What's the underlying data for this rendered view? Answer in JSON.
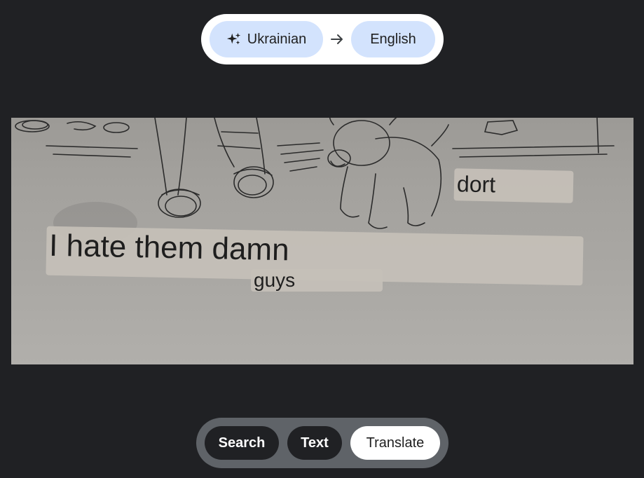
{
  "language_bar": {
    "source_language": "Ukrainian",
    "target_language": "English",
    "source_icon": "sparkle-icon",
    "swap_icon": "arrow-right-icon"
  },
  "image": {
    "description_icon": "sketch-image",
    "overlays": [
      {
        "id": "dort",
        "text": "dort"
      },
      {
        "id": "main",
        "text": "I hate them damn"
      },
      {
        "id": "guys",
        "text": "guys"
      }
    ]
  },
  "modes": {
    "search_label": "Search",
    "text_label": "Text",
    "translate_label": "Translate",
    "active": "Translate"
  },
  "colors": {
    "background": "#202124",
    "pill_blue": "#d3e3fd",
    "mode_bar": "#5f6368"
  }
}
